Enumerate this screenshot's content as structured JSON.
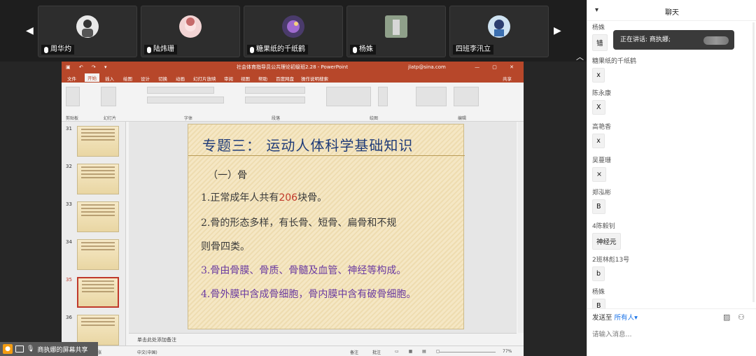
{
  "participants": [
    {
      "name": "周华灼",
      "avatar_color": "#e8e8e8"
    },
    {
      "name": "陆炜珊",
      "avatar_color": "#f2d4d4"
    },
    {
      "name": "糖果纸的千纸鹤",
      "avatar_color": "#4a3b6b"
    },
    {
      "name": "杨姝",
      "avatar_color": "#8fa08a"
    },
    {
      "name": "四班李汛立",
      "avatar_color": "#cfe3f2"
    }
  ],
  "ppt": {
    "title": "社会体育指导员公共理论初级班2.28  -  PowerPoint",
    "account": "jlatp@sina.com",
    "tabs": [
      "文件",
      "开始",
      "插入",
      "绘图",
      "设计",
      "切换",
      "动画",
      "幻灯片放映",
      "审阅",
      "视图",
      "帮助",
      "百度网盘",
      "操作说明搜索"
    ],
    "share": "共享",
    "ribbon_groups": [
      "剪贴板",
      "幻灯片",
      "字体",
      "段落",
      "绘图",
      "编辑"
    ],
    "slide_numbers": [
      "31",
      "32",
      "33",
      "34",
      "35",
      "36"
    ],
    "selected_slide": "35",
    "slide": {
      "title": "专题三：  运动人体科学基础知识",
      "subtitle": "（一）骨",
      "p1_a": "1.正常成年人共有",
      "p1_num": "206",
      "p1_b": "块骨。",
      "p2_a": "2.骨的形态多样，有长骨、短骨、扁骨和不规",
      "p2_b": "则骨四类。",
      "p3": "3.骨由骨膜、骨质、骨髓及血管、神经等构成。",
      "p4": "4.骨外膜中含成骨细胞，骨内膜中含有破骨细胞。"
    },
    "notes_placeholder": "单击此处添加备注",
    "status": {
      "slide_info": "幻 282 张",
      "language": "中文(中国)",
      "notes_btn": "备注",
      "comments_btn": "批注",
      "zoom": "77%"
    }
  },
  "share_bar": {
    "label": "商执娜的屏幕共享"
  },
  "chat": {
    "title": "聊天",
    "toast": "正在讲话: 商执娜;",
    "messages": [
      {
        "sender": "杨姝",
        "text": "错"
      },
      {
        "sender": "糖果纸的千纸鹤",
        "text": "x"
      },
      {
        "sender": "陈永康",
        "text": "X"
      },
      {
        "sender": "高艳香",
        "text": "x"
      },
      {
        "sender": "吴蔓珊",
        "text": "×"
      },
      {
        "sender": "郑泓彬",
        "text": "B"
      },
      {
        "sender": "4陈毅钊",
        "text": "神经元"
      },
      {
        "sender": "2班林彪13号",
        "text": "b"
      },
      {
        "sender": "杨姝",
        "text": "B"
      }
    ],
    "send_to_label": "发送至",
    "send_to_value": "所有人",
    "input_placeholder": "请输入消息..."
  }
}
